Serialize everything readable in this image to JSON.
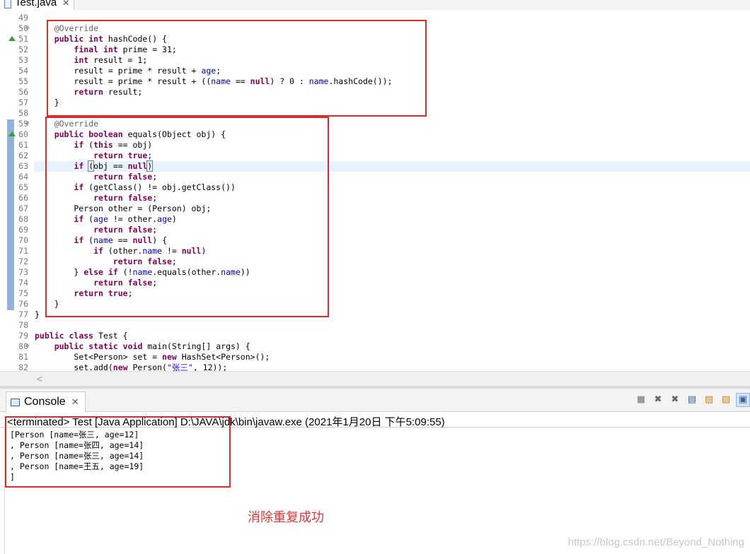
{
  "editor_tab": {
    "label": "Test.java",
    "close": "✕"
  },
  "code_lines": [
    {
      "n": "49",
      "html": ""
    },
    {
      "n": "50",
      "fold": "⊖",
      "html": "    <span class=\"a\">@Override</span>"
    },
    {
      "n": "51",
      "override": true,
      "html": "    <span class=\"k\">public</span> <span class=\"k\">int</span> hashCode() {"
    },
    {
      "n": "52",
      "html": "        <span class=\"k\">final</span> <span class=\"k\">int</span> prime = 31;"
    },
    {
      "n": "53",
      "html": "        <span class=\"k\">int</span> result = 1;"
    },
    {
      "n": "54",
      "html": "        result = prime * result + <span class=\"f\">age</span>;"
    },
    {
      "n": "55",
      "html": "        result = prime * result + ((<span class=\"f\">name</span> == <span class=\"k\">null</span>) ? 0 : <span class=\"f\">name</span>.hashCode());"
    },
    {
      "n": "56",
      "html": "        <span class=\"k\">return</span> result;"
    },
    {
      "n": "57",
      "html": "    }"
    },
    {
      "n": "58",
      "html": ""
    },
    {
      "n": "59",
      "fold": "⊖",
      "html": "    <span class=\"a\">@Override</span>"
    },
    {
      "n": "60",
      "override": true,
      "html": "    <span class=\"k\">public</span> <span class=\"k\">boolean</span> equals(Object obj) {"
    },
    {
      "n": "61",
      "html": "        <span class=\"k\">if</span> (<span class=\"k\">this</span> == obj)"
    },
    {
      "n": "62",
      "html": "            <span class=\"k\">return</span> <span class=\"k\">true</span>;"
    },
    {
      "n": "63",
      "highlight": true,
      "html": "        <span class=\"k\">if</span> <span class=\"caretbox\">(</span>obj == <span class=\"k\">null</span><span class=\"caretbox\">)</span>"
    },
    {
      "n": "64",
      "html": "            <span class=\"k\">return</span> <span class=\"k\">false</span>;"
    },
    {
      "n": "65",
      "html": "        <span class=\"k\">if</span> (getClass() != obj.getClass())"
    },
    {
      "n": "66",
      "html": "            <span class=\"k\">return</span> <span class=\"k\">false</span>;"
    },
    {
      "n": "67",
      "html": "        Person other = (Person) obj;"
    },
    {
      "n": "68",
      "html": "        <span class=\"k\">if</span> (<span class=\"f\">age</span> != other.<span class=\"f\">age</span>)"
    },
    {
      "n": "69",
      "html": "            <span class=\"k\">return</span> <span class=\"k\">false</span>;"
    },
    {
      "n": "70",
      "html": "        <span class=\"k\">if</span> (<span class=\"f\">name</span> == <span class=\"k\">null</span>) {"
    },
    {
      "n": "71",
      "html": "            <span class=\"k\">if</span> (other.<span class=\"f\">name</span> != <span class=\"k\">null</span>)"
    },
    {
      "n": "72",
      "html": "                <span class=\"k\">return</span> <span class=\"k\">false</span>;"
    },
    {
      "n": "73",
      "html": "        } <span class=\"k\">else</span> <span class=\"k\">if</span> (!<span class=\"f\">name</span>.equals(other.<span class=\"f\">name</span>))"
    },
    {
      "n": "74",
      "html": "            <span class=\"k\">return</span> <span class=\"k\">false</span>;"
    },
    {
      "n": "75",
      "html": "        <span class=\"k\">return</span> <span class=\"k\">true</span>;"
    },
    {
      "n": "76",
      "html": "    }"
    },
    {
      "n": "77",
      "html": "}"
    },
    {
      "n": "78",
      "html": ""
    },
    {
      "n": "79",
      "html": "<span class=\"k\">public</span> <span class=\"k\">class</span> Test {"
    },
    {
      "n": "80",
      "fold": "⊖",
      "html": "    <span class=\"k\">public</span> <span class=\"k\">static</span> <span class=\"k\">void</span> main(String[] args) {"
    },
    {
      "n": "81",
      "html": "        Set&lt;Person&gt; set = <span class=\"k\">new</span> HashSet&lt;Person&gt;();"
    },
    {
      "n": "82",
      "html": "        set.add(<span class=\"k\">new</span> Person(<span class=\"s\">\"张三\"</span>, 12));"
    }
  ],
  "scroll_arrow": "<",
  "console": {
    "tab_label": "Console",
    "tab_close": "✕",
    "status": "<terminated> Test [Java Application] D:\\JAVA\\jdk\\bin\\javaw.exe (2021年1月20日 下午5:09:55)",
    "output": [
      "[Person [name=张三, age=12]",
      ", Person [name=张四, age=14]",
      ", Person [name=张三, age=14]",
      ", Person [name=王五, age=19]",
      "]"
    ],
    "tools": [
      "■",
      "✖",
      "✖",
      "▤",
      "▧",
      "▨",
      "▣"
    ]
  },
  "annotation": "消除重复成功",
  "watermark": "https://blog.csdn.net/Beyond_Nothing"
}
